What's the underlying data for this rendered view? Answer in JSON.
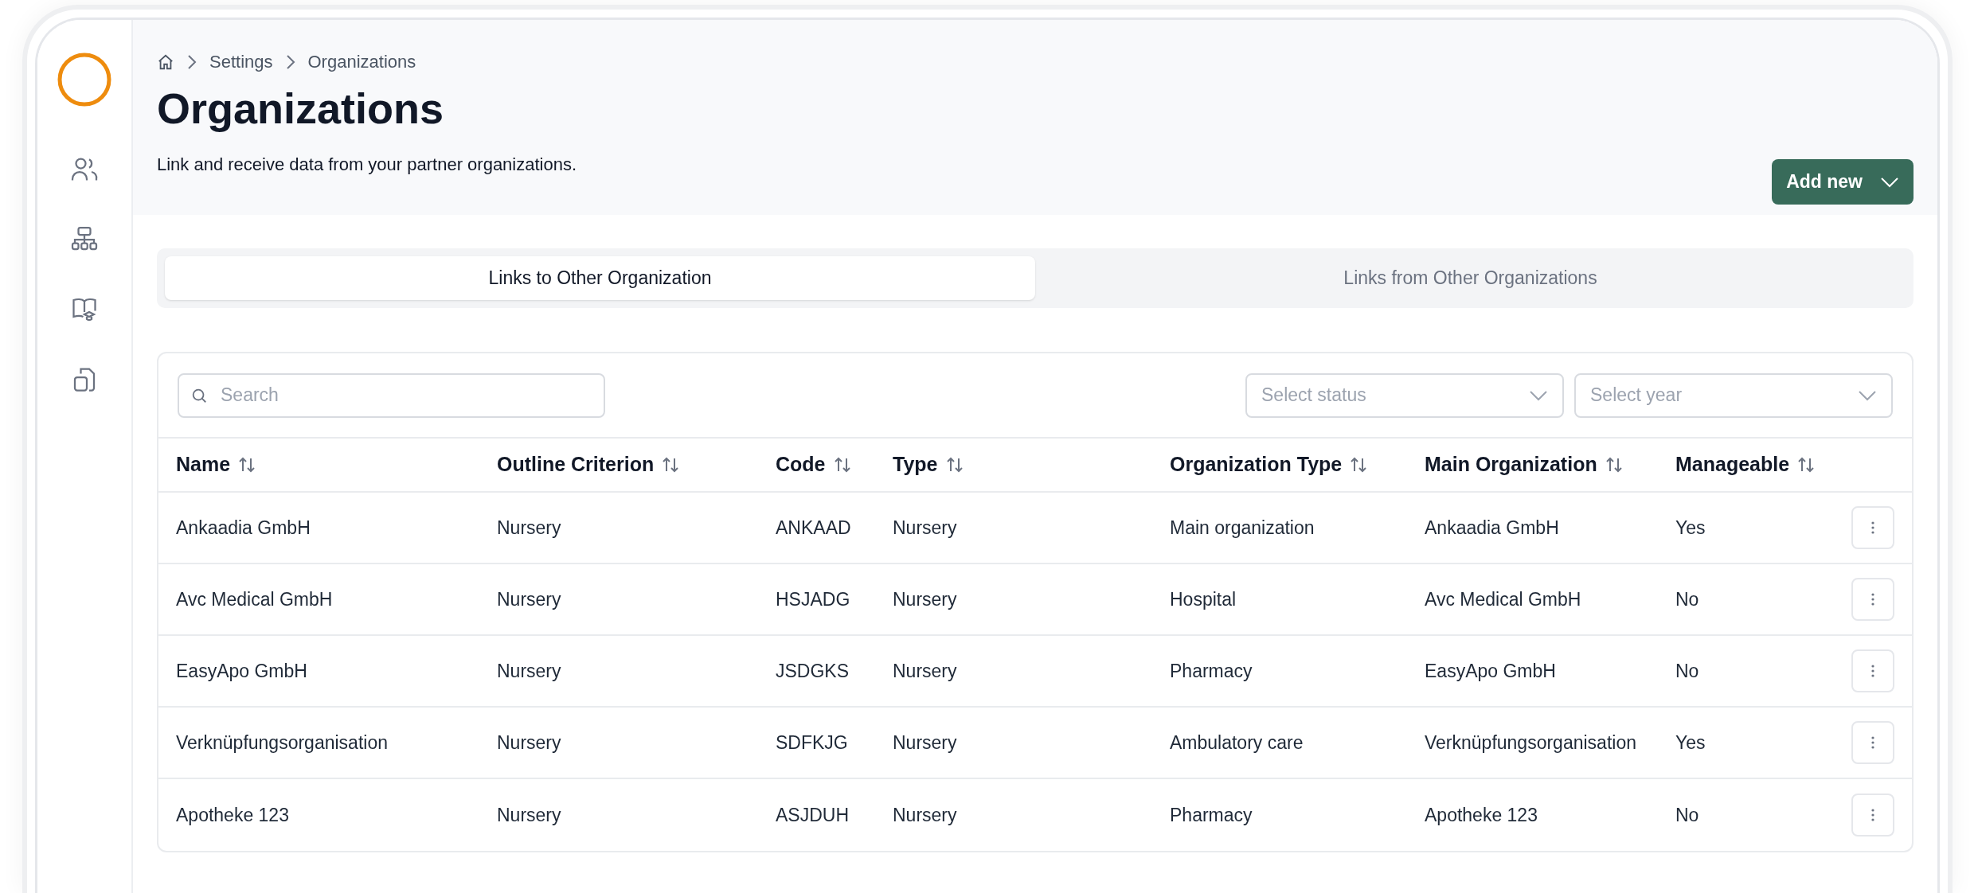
{
  "breadcrumb": [
    "Settings",
    "Organizations"
  ],
  "page": {
    "title": "Organizations",
    "subtitle": "Link and receive data from your partner organizations.",
    "add_button": "Add new"
  },
  "tabs": [
    {
      "label": "Links to Other Organization",
      "selected": true
    },
    {
      "label": "Links from Other Organizations",
      "selected": false
    }
  ],
  "filters": {
    "search": {
      "placeholder": "Search"
    },
    "status": {
      "placeholder": "Select status"
    },
    "year": {
      "placeholder": "Select year"
    }
  },
  "table": {
    "columns": [
      "Name",
      "Outline Criterion",
      "Code",
      "Type",
      "Organization Type",
      "Main Organization",
      "Manageable"
    ],
    "rows": [
      [
        "Ankaadia GmbH",
        "Nursery",
        "ANKAAD",
        "Nursery",
        "Main organization",
        "Ankaadia GmbH",
        "Yes"
      ],
      [
        "Avc Medical GmbH",
        "Nursery",
        "HSJADG",
        "Nursery",
        "Hospital",
        "Avc Medical GmbH",
        "No"
      ],
      [
        "EasyApo GmbH",
        "Nursery",
        "JSDGKS",
        "Nursery",
        "Pharmacy",
        "EasyApo GmbH",
        "No"
      ],
      [
        "Verknüpfungsorganisation",
        "Nursery",
        "SDFKJG",
        "Nursery",
        "Ambulatory care",
        "Verknüpfungsorganisation",
        "Yes"
      ],
      [
        "Apotheke 123",
        "Nursery",
        "ASJDUH",
        "Nursery",
        "Pharmacy",
        "Apotheke 123",
        "No"
      ]
    ]
  }
}
